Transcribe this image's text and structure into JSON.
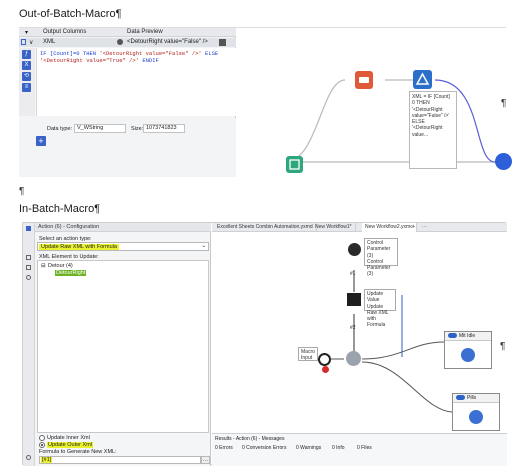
{
  "doc": {
    "heading_out": "Out-of-Batch-Macro¶",
    "heading_in": "In-Batch-Macro¶",
    "pilcrow": "¶"
  },
  "shot1": {
    "header_output_columns": "Output Columns",
    "header_data_preview": "Data Preview",
    "row_column_name": "XML",
    "row_preview": "<DetourRight value=\"False\" />",
    "formula_line1_kw": "IF [Count]=0 THEN",
    "formula_line1_str": " '<DetourRight value=\"False\" />'",
    "formula_line1_kw2": " ELSE",
    "formula_line2_str": "'<DetourRight value=\"True\" />'",
    "formula_line2_kw": " ENDIF",
    "data_type_label": "Data type:",
    "data_type_value": "V_WString",
    "size_label": "Size:",
    "size_value": "1073741823",
    "plus_label": "+",
    "annotation": [
      "XML = IF [Count]",
      "0 THEN",
      "'<DetourRight",
      "value=\"False\" />'",
      "ELSE",
      "'<DetourRight",
      "value..."
    ]
  },
  "shot2": {
    "panel_title": "Action (6) - Configuration",
    "select_action_label": "Select an action type:",
    "select_action_value": "Update Raw XML with Formula",
    "xml_element_label": "XML Element to Update:",
    "tree_root": "Detour (4)",
    "tree_child": "DetourRight",
    "radio_inner": "Update Inner Xml",
    "radio_outer": "Update Outer Xml",
    "formula_label": "Formula to Generate New XML:",
    "formula_value": "[#1]",
    "tabs": [
      "Excellent Sheets Combin Automation.yxmd",
      "New Workflow1*",
      "New Workflow2.yxmc"
    ],
    "annot_control": [
      "Control",
      "Parameter (3)",
      "Control",
      "Parameter (3)"
    ],
    "annot_action": [
      "Update Value",
      "Update Raw XML",
      "with Formula"
    ],
    "annot_macro": [
      "Macro",
      "Input"
    ],
    "container_true": "Mit Idle",
    "container_false": "Pills",
    "results_title": "Results - Action (6) - Messages",
    "results_items": [
      "0 Errors",
      "0 Conversion Errors",
      "0 Warnings",
      "0 Info",
      "0 Files"
    ],
    "label_a": "#1",
    "label_b": "#2"
  }
}
